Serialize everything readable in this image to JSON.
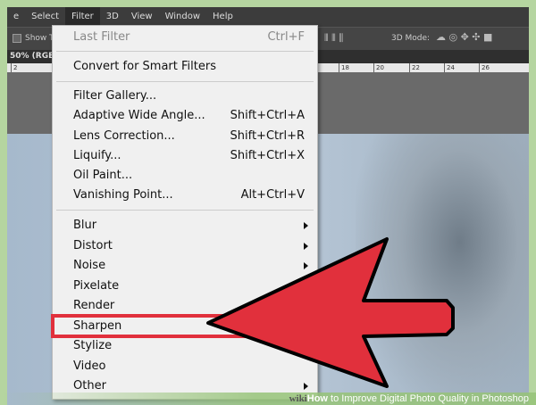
{
  "menubar": [
    "e",
    "Select",
    "Filter",
    "3D",
    "View",
    "Window",
    "Help"
  ],
  "options": {
    "checkbox_label": "Show Tr",
    "mode_label": "3D Mode:"
  },
  "doc_tab": "50% (RGB/",
  "ruler": [
    "2",
    "18",
    "20",
    "22",
    "24",
    "26"
  ],
  "menu": {
    "last_filter": {
      "label": "Last Filter",
      "shortcut": "Ctrl+F"
    },
    "convert": "Convert for Smart Filters",
    "group1": [
      {
        "label": "Filter Gallery...",
        "shortcut": ""
      },
      {
        "label": "Adaptive Wide Angle...",
        "shortcut": "Shift+Ctrl+A"
      },
      {
        "label": "Lens Correction...",
        "shortcut": "Shift+Ctrl+R"
      },
      {
        "label": "Liquify...",
        "shortcut": "Shift+Ctrl+X"
      },
      {
        "label": "Oil Paint...",
        "shortcut": ""
      },
      {
        "label": "Vanishing Point...",
        "shortcut": "Alt+Ctrl+V"
      }
    ],
    "group2": [
      "Blur",
      "Distort",
      "Noise",
      "Pixelate",
      "Render",
      "Sharpen",
      "Stylize",
      "Video",
      "Other"
    ]
  },
  "highlight_color": "#e1303c",
  "watermark": {
    "brand": "wiki",
    "brand2": "How",
    "text": " to Improve Digital Photo Quality in Photoshop"
  }
}
